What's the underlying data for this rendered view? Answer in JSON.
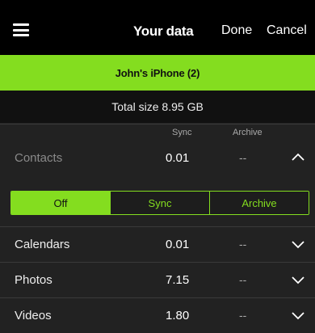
{
  "header": {
    "title": "Your data",
    "done_label": "Done",
    "cancel_label": "Cancel",
    "menu_icon": "hamburger-menu-icon"
  },
  "device": {
    "name": "John's iPhone (2)"
  },
  "summary": {
    "total": "Total size 8.95 GB"
  },
  "columns": {
    "sync": "Sync",
    "archive": "Archive"
  },
  "rows": [
    {
      "name": "Contacts",
      "sync": "0.01",
      "archive": "--",
      "expanded": true,
      "chevron_icon": "chevron-up-icon"
    },
    {
      "name": "Calendars",
      "sync": "0.01",
      "archive": "--",
      "expanded": false,
      "chevron_icon": "chevron-down-icon"
    },
    {
      "name": "Photos",
      "sync": "7.15",
      "archive": "--",
      "expanded": false,
      "chevron_icon": "chevron-down-icon"
    },
    {
      "name": "Videos",
      "sync": "1.80",
      "archive": "--",
      "expanded": false,
      "chevron_icon": "chevron-down-icon"
    }
  ],
  "contacts_mode": {
    "options": [
      "Off",
      "Sync",
      "Archive"
    ],
    "selected": "Off"
  },
  "colors": {
    "accent": "#84dd1f",
    "header_bg": "#000000",
    "page_bg": "#222222"
  }
}
